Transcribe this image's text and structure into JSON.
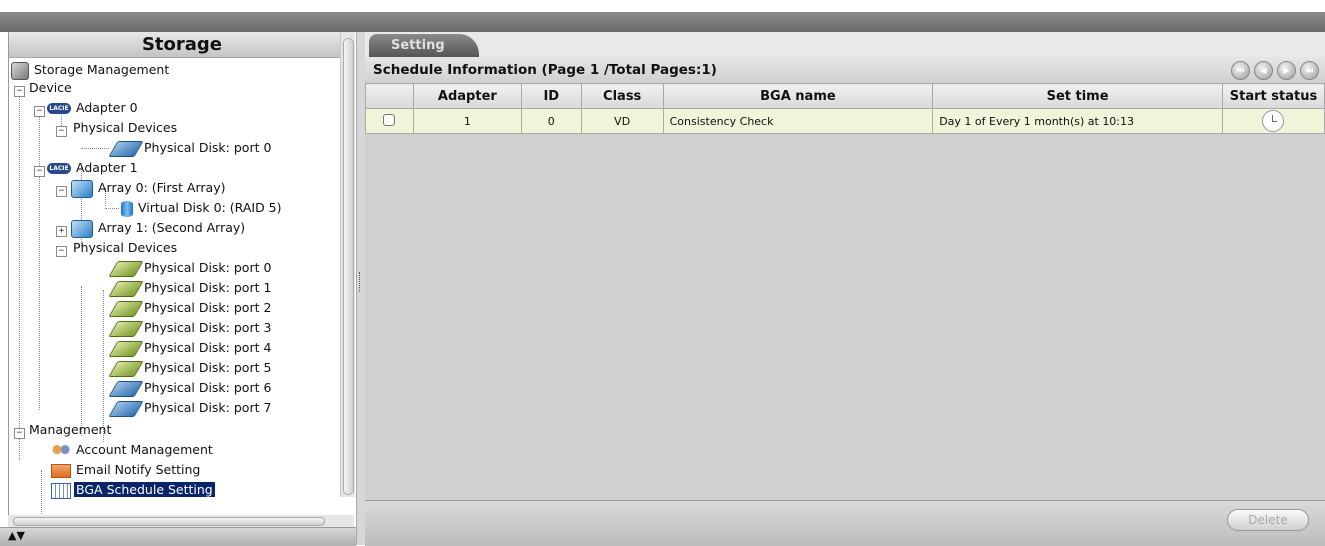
{
  "sidebar": {
    "title": "Storage",
    "tree": {
      "storage_management": "Storage Management",
      "device": "Device",
      "adapter0": "Adapter 0",
      "adapter0_physical": "Physical Devices",
      "adapter0_disk0": "Physical Disk: port 0",
      "adapter1": "Adapter 1",
      "array0": "Array 0: (First Array)",
      "vdisk0": "Virtual Disk 0: (RAID 5)",
      "array1": "Array 1: (Second Array)",
      "adapter1_physical": "Physical Devices",
      "disks": [
        "Physical Disk: port 0",
        "Physical Disk: port 1",
        "Physical Disk: port 2",
        "Physical Disk: port 3",
        "Physical Disk: port 4",
        "Physical Disk: port 5",
        "Physical Disk: port 6",
        "Physical Disk: port 7"
      ],
      "management": "Management",
      "account": "Account Management",
      "email": "Email Notify Setting",
      "bga": "BGA Schedule Setting",
      "adapter_icon_text": "LACIE",
      "expand_glyph": "+",
      "collapse_glyph": "−"
    },
    "bottom_arrows": "▲▼"
  },
  "tab": {
    "label": "Setting"
  },
  "schedule": {
    "title": "Schedule Information (Page 1 /Total Pages:1)",
    "pager": [
      "⏮",
      "◀",
      "▶",
      "⏭"
    ],
    "columns": [
      "",
      "Adapter",
      "ID",
      "Class",
      "BGA name",
      "Set time",
      "Start status"
    ],
    "rows": [
      {
        "adapter": "1",
        "id": "0",
        "class": "VD",
        "bga_name": "Consistency Check",
        "set_time": "Day 1 of Every 1 month(s) at 10:13",
        "start_status": "clock-icon"
      }
    ]
  },
  "footer": {
    "delete_label": "Delete"
  },
  "colors": {
    "row_bg": "#eef5d8",
    "selection": "#0a246a",
    "tab_bg": "#6e6e6e"
  }
}
